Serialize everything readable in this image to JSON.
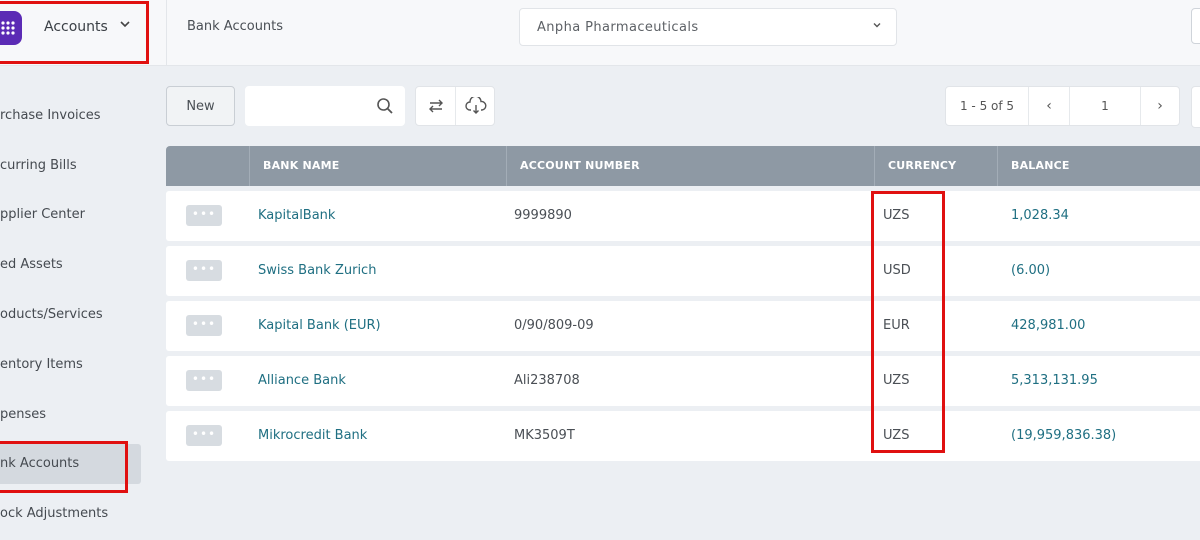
{
  "header": {
    "app_name": "Accounts",
    "breadcrumb": "Bank Accounts",
    "company": "Anpha Pharmaceuticals"
  },
  "sidebar": {
    "items": [
      {
        "label": "rchase Invoices"
      },
      {
        "label": "curring Bills"
      },
      {
        "label": "pplier Center"
      },
      {
        "label": "ed Assets"
      },
      {
        "label": "oducts/Services"
      },
      {
        "label": "entory Items"
      },
      {
        "label": "penses"
      },
      {
        "label": "nk Accounts"
      },
      {
        "label": "ock Adjustments"
      }
    ],
    "active_index": 7
  },
  "toolbar": {
    "new_label": "New",
    "search_placeholder": "",
    "pager_range": "1 - 5 of 5",
    "page": "1",
    "prev_glyph": "‹",
    "next_glyph": "›"
  },
  "table": {
    "columns": [
      "BANK NAME",
      "ACCOUNT NUMBER",
      "CURRENCY",
      "BALANCE"
    ],
    "rows": [
      {
        "bank": "KapitalBank",
        "account": "9999890",
        "currency": "UZS",
        "balance": "1,028.34"
      },
      {
        "bank": "Swiss Bank Zurich",
        "account": "",
        "currency": "USD",
        "balance": "(6.00)"
      },
      {
        "bank": "Kapital Bank (EUR)",
        "account": "0/90/809-09",
        "currency": "EUR",
        "balance": "428,981.00"
      },
      {
        "bank": "Alliance Bank",
        "account": "Ali238708",
        "currency": "UZS",
        "balance": "5,313,131.95"
      },
      {
        "bank": "Mikrocredit Bank",
        "account": "MK3509T",
        "currency": "UZS",
        "balance": "(19,959,836.38)"
      }
    ],
    "row_action_glyph": "•••"
  },
  "colors": {
    "link": "#1f6f82",
    "header_bg": "#8e99a4",
    "annotation": "#e01010",
    "logo": "#5b2bb5"
  },
  "icons": {
    "logo": "keypad-logo-icon",
    "app_switch": "chevron-down-icon",
    "search": "search-icon",
    "refresh": "swap-arrows-icon",
    "download": "cloud-download-icon"
  }
}
